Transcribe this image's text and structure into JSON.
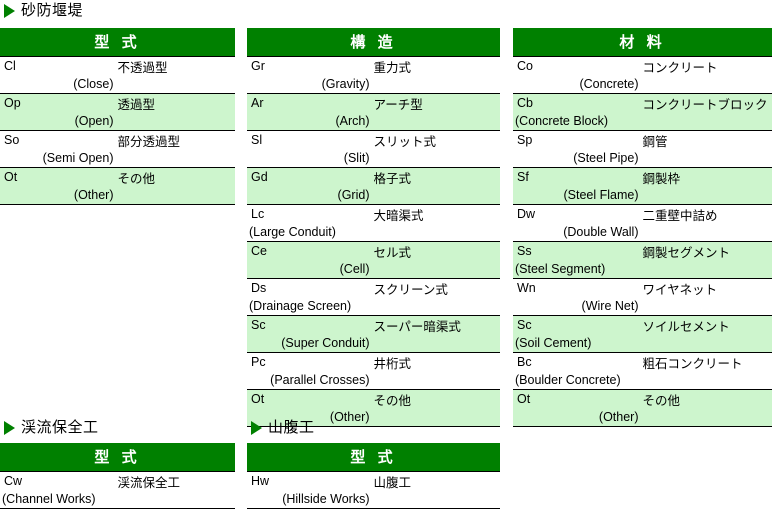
{
  "sections": [
    {
      "id": "sabo-dam",
      "title": "砂防堰堤",
      "bullet_icon": "triangle-right-icon",
      "tables": [
        {
          "id": "type",
          "header": "型 式",
          "rows": [
            {
              "abbr": "Cl",
              "english": "(Close)",
              "japanese": "不透過型",
              "align": "right"
            },
            {
              "abbr": "Op",
              "english": "(Open)",
              "japanese": "透過型",
              "align": "right"
            },
            {
              "abbr": "So",
              "english": "(Semi Open)",
              "japanese": "部分透過型",
              "align": "right"
            },
            {
              "abbr": "Ot",
              "english": "(Other)",
              "japanese": "その他",
              "align": "right"
            }
          ]
        },
        {
          "id": "structure",
          "header": "構 造",
          "rows": [
            {
              "abbr": "Gr",
              "english": "(Gravity)",
              "japanese": "重力式",
              "align": "right"
            },
            {
              "abbr": "Ar",
              "english": "(Arch)",
              "japanese": "アーチ型",
              "align": "right"
            },
            {
              "abbr": "Sl",
              "english": "(Slit)",
              "japanese": "スリット式",
              "align": "right"
            },
            {
              "abbr": "Gd",
              "english": "(Grid)",
              "japanese": "格子式",
              "align": "right"
            },
            {
              "abbr": "Lc",
              "english": "(Large Conduit)",
              "japanese": "大暗渠式",
              "align": "right"
            },
            {
              "abbr": "Ce",
              "english": "(Cell)",
              "japanese": "セル式",
              "align": "right"
            },
            {
              "abbr": "Ds",
              "english": "(Drainage Screen)",
              "japanese": "スクリーン式",
              "align": "left"
            },
            {
              "abbr": "Sc",
              "english": "(Super Conduit)",
              "japanese": "スーパー暗渠式",
              "align": "right"
            },
            {
              "abbr": "Pc",
              "english": "(Parallel Crosses)",
              "japanese": "井桁式",
              "align": "right"
            },
            {
              "abbr": "Ot",
              "english": "(Other)",
              "japanese": "その他",
              "align": "right"
            }
          ]
        },
        {
          "id": "material",
          "header": "材 料",
          "rows": [
            {
              "abbr": "Co",
              "english": "(Concrete)",
              "japanese": "コンクリート",
              "align": "right"
            },
            {
              "abbr": "Cb",
              "english": "(Concrete Block)",
              "japanese": "コンクリートブロック",
              "align": "right"
            },
            {
              "abbr": "Sp",
              "english": "(Steel Pipe)",
              "japanese": "鋼管",
              "align": "right"
            },
            {
              "abbr": "Sf",
              "english": "(Steel Flame)",
              "japanese": "鋼製枠",
              "align": "right"
            },
            {
              "abbr": "Dw",
              "english": "(Double Wall)",
              "japanese": "二重壁中詰め",
              "align": "right"
            },
            {
              "abbr": "Ss",
              "english": "(Steel Segment)",
              "japanese": "鋼製セグメント",
              "align": "right"
            },
            {
              "abbr": "Wn",
              "english": "(Wire Net)",
              "japanese": "ワイヤネット",
              "align": "right"
            },
            {
              "abbr": "Sc",
              "english": "(Soil Cement)",
              "japanese": "ソイルセメント",
              "align": "right"
            },
            {
              "abbr": "Bc",
              "english": "(Boulder Concrete)",
              "japanese": "粗石コンクリート",
              "align": "left"
            },
            {
              "abbr": "Ot",
              "english": "(Other)",
              "japanese": "その他",
              "align": "right"
            }
          ]
        }
      ]
    },
    {
      "id": "keiryu-hozenko",
      "title": "渓流保全工",
      "bullet_icon": "triangle-right-icon",
      "tables": [
        {
          "id": "type",
          "header": "型 式",
          "rows": [
            {
              "abbr": "Cw",
              "english": "(Channel Works)",
              "japanese": "渓流保全工",
              "align": "left"
            }
          ]
        }
      ]
    },
    {
      "id": "sanpukuko",
      "title": "山腹工",
      "bullet_icon": "triangle-right-icon",
      "tables": [
        {
          "id": "type",
          "header": "型 式",
          "rows": [
            {
              "abbr": "Hw",
              "english": "(Hillside Works)",
              "japanese": "山腹工",
              "align": "right"
            }
          ]
        }
      ]
    }
  ],
  "colors": {
    "header_green": "#008000",
    "row_light_green": "#cdf5cd",
    "row_white": "#ffffff",
    "text": "#000000",
    "header_text": "#ffffff"
  }
}
